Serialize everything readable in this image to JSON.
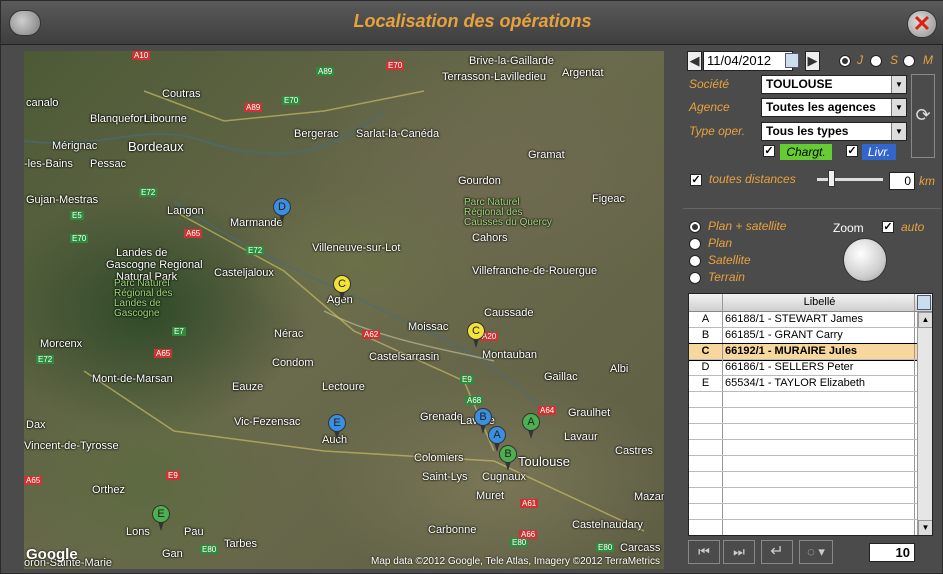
{
  "window": {
    "title": "Localisation des opérations"
  },
  "map": {
    "attribution": "Map data ©2012 Google, Tele Atlas, Imagery ©2012 TerraMetrics",
    "logo": "Google",
    "places": [
      {
        "text": "Brive-la-Gaillarde"
      },
      {
        "text": "Argentat"
      },
      {
        "text": "Terrasson-Lavilledieu"
      },
      {
        "text": "Coutras"
      },
      {
        "text": "canalo"
      },
      {
        "text": "Blanquefort"
      },
      {
        "text": "Libourne"
      },
      {
        "text": "Bergerac"
      },
      {
        "text": "Sarlat-la-Canéda"
      },
      {
        "text": "Mérignac"
      },
      {
        "text": "Bordeaux"
      },
      {
        "text": "Pessac"
      },
      {
        "text": "-les-Bains"
      },
      {
        "text": "Gramat"
      },
      {
        "text": "Gujan-Mestras"
      },
      {
        "text": "Gourdon"
      },
      {
        "text": "Langon"
      },
      {
        "text": "Figeac"
      },
      {
        "text": "Marmande"
      },
      {
        "text": "Cahors"
      },
      {
        "text": "Villeneuve-sur-Lot"
      },
      {
        "text": "Landes de"
      },
      {
        "text": "Gascogne Regional"
      },
      {
        "text": "Natural Park"
      },
      {
        "text": "Casteljaloux"
      },
      {
        "text": "Villefranche-de-Rouergue"
      },
      {
        "text": "Agen"
      },
      {
        "text": "Caussade"
      },
      {
        "text": "Moissac"
      },
      {
        "text": "Nérac"
      },
      {
        "text": "Morcenx"
      },
      {
        "text": "Castelsarrasin"
      },
      {
        "text": "Montauban"
      },
      {
        "text": "Condom"
      },
      {
        "text": "Gaillac"
      },
      {
        "text": "Albi"
      },
      {
        "text": "Mont-de-Marsan"
      },
      {
        "text": "Eauze"
      },
      {
        "text": "Lectoure"
      },
      {
        "text": "Grenade"
      },
      {
        "text": "Graulhet"
      },
      {
        "text": "Dax"
      },
      {
        "text": "Vic-Fezensac"
      },
      {
        "text": "Lavaur"
      },
      {
        "text": "Auch"
      },
      {
        "text": "Vincent-de-Tyrosse"
      },
      {
        "text": "Colomiers"
      },
      {
        "text": "Toulouse"
      },
      {
        "text": "Castres"
      },
      {
        "text": "Saint-Lys"
      },
      {
        "text": "Cugnaux"
      },
      {
        "text": "Orthez"
      },
      {
        "text": "Muret"
      },
      {
        "text": "Castelnaudary"
      },
      {
        "text": "Carbonne"
      },
      {
        "text": "Lons"
      },
      {
        "text": "Pau"
      },
      {
        "text": "Tarbes"
      },
      {
        "text": "Carcass"
      },
      {
        "text": "Gan"
      },
      {
        "text": "oron-Sainte-Marie"
      },
      {
        "text": "Parc Naturel Régional des Causses du Quercy"
      },
      {
        "text": "Parc Naturel Régional des Landes de Gascogne"
      },
      {
        "text": "Lavalle"
      },
      {
        "text": "Mazamet"
      }
    ],
    "roads": [
      "A10",
      "A89",
      "E70",
      "A89",
      "E70",
      "E72",
      "E5",
      "E70",
      "A65",
      "E72",
      "A62",
      "A20",
      "E7",
      "A65",
      "E72",
      "E9",
      "A68",
      "A64",
      "A65",
      "E9",
      "E80",
      "A61",
      "A66",
      "E80",
      "E80"
    ],
    "markers": [
      {
        "label": "D",
        "color": "#3a8fe0"
      },
      {
        "label": "C",
        "color": "#f2e23a"
      },
      {
        "label": "C",
        "color": "#f2e23a"
      },
      {
        "label": "E",
        "color": "#3a8fe0"
      },
      {
        "label": "B",
        "color": "#3a8fe0"
      },
      {
        "label": "A",
        "color": "#3a8fe0"
      },
      {
        "label": "A",
        "color": "#4caf50"
      },
      {
        "label": "B",
        "color": "#4caf50"
      },
      {
        "label": "E",
        "color": "#4caf50"
      }
    ]
  },
  "filters": {
    "date": "11/04/2012",
    "period_j": "J",
    "period_s": "S",
    "period_m": "M",
    "societe_label": "Société",
    "societe_value": "TOULOUSE",
    "agence_label": "Agence",
    "agence_value": "Toutes les agences",
    "type_label": "Type oper.",
    "type_value": "Tous les types",
    "chargt": "Chargt.",
    "livr": "Livr.",
    "distances_label": "toutes distances",
    "distance_value": "0",
    "distance_unit": "km"
  },
  "view": {
    "plan_sat": "Plan + satellite",
    "plan": "Plan",
    "satellite": "Satellite",
    "terrain": "Terrain",
    "zoom": "Zoom",
    "auto": "auto"
  },
  "grid": {
    "header": "Libellé",
    "rows": [
      {
        "key": "A",
        "label": "66188/1 - STEWART James"
      },
      {
        "key": "B",
        "label": "66185/1 - GRANT Carry"
      },
      {
        "key": "C",
        "label": "66192/1 - MURAIRE Jules"
      },
      {
        "key": "D",
        "label": "66186/1 - SELLERS Peter"
      },
      {
        "key": "E",
        "label": "65534/1 - TAYLOR Elizabeth"
      }
    ]
  },
  "footer": {
    "count": "10"
  }
}
